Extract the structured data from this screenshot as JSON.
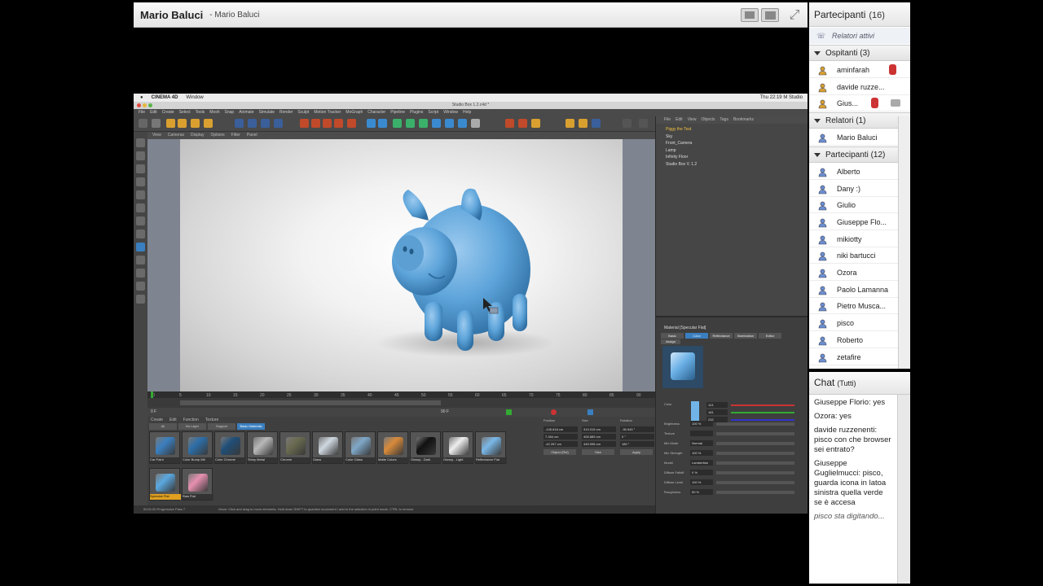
{
  "share_pod": {
    "presenter_name": "Mario Baluci",
    "subtitle": "- Mario Baluci",
    "mac_menu": [
      "CINEMA 4D",
      "Window"
    ],
    "mac_status": "Thu 22:19  M Studio",
    "c4d_title": "Studio Box 1.2.c4d *",
    "c4d_menu": [
      "File",
      "Edit",
      "Create",
      "Select",
      "Tools",
      "Mesh",
      "Snap",
      "Animate",
      "Simulate",
      "Render",
      "Sculpt",
      "Motion Tracker",
      "MoGraph",
      "Character",
      "Pipeline",
      "Plugins",
      "Script",
      "Window",
      "Help"
    ],
    "viewport_menu": [
      "View",
      "Cameras",
      "Display",
      "Options",
      "Filter",
      "Panel"
    ],
    "objects": [
      "Piggy the Test",
      "Sky",
      "Front_Camera",
      "Lamp",
      "Infinity Floor",
      "Studio Box V. 1.2"
    ],
    "object_manager_menu": [
      "File",
      "Edit",
      "View",
      "Objects",
      "Tags",
      "Bookmarks"
    ],
    "material_menu": [
      "Create",
      "Edit",
      "Function",
      "Texture"
    ],
    "material_tabs": [
      "All",
      "No Layer",
      "Support",
      "Basic Materials"
    ],
    "materials": [
      {
        "label": "Car Paint",
        "color": "#3a7fc0"
      },
      {
        "label": "Color Bump Mtl",
        "color": "#2c6ea8"
      },
      {
        "label": "Color Chrome",
        "color": "#1f4e78"
      },
      {
        "label": "Shiny Metal",
        "color": "#b8b8b8"
      },
      {
        "label": "Chrome",
        "color": "#6a6a50"
      },
      {
        "label": "Glass",
        "color": "#cfd8e0"
      },
      {
        "label": "Color Glass",
        "color": "#7fa8c8"
      },
      {
        "label": "Matte Colors",
        "color": "#d98a3a"
      },
      {
        "label": "Glossy - Dark",
        "color": "#111111"
      },
      {
        "label": "Glossy - Light",
        "color": "#eeeeee"
      },
      {
        "label": "Reflectance Flat",
        "color": "#7ab8e8"
      },
      {
        "label": "Specular Flat",
        "color": "#5aa8e0"
      },
      {
        "label": "Raw Flat",
        "color": "#e890b0"
      }
    ],
    "coord_labels": [
      "Position",
      "Size",
      "Rotation"
    ],
    "coord_values": [
      "-135.618 cm",
      "319.315 cm",
      "-35.945 °",
      "7.284 cm",
      "406.889 cm",
      "0 °",
      "-42.267 cm",
      "445.998 cm",
      "180 °"
    ],
    "coord_buttons": [
      "Object (Rel)",
      "Size",
      "Apply"
    ],
    "attr_title": "Material [Specular Flat]",
    "attr_tabs": [
      "Basic",
      "Color",
      "Reflectance",
      "Illumination",
      "Editor"
    ],
    "attr_assign": "Assign",
    "attr_fields": [
      {
        "label": "Color",
        "value": ""
      },
      {
        "label": "Brightness",
        "value": "100 %"
      },
      {
        "label": "Texture",
        "value": ""
      },
      {
        "label": "Mix Mode",
        "value": "Normal"
      },
      {
        "label": "Mix Strength",
        "value": "100 %"
      },
      {
        "label": "Model",
        "value": "Lambertian"
      },
      {
        "label": "Diffuse Falloff",
        "value": "0 %"
      },
      {
        "label": "Diffuse Level",
        "value": "100 %"
      },
      {
        "label": "Roughness",
        "value": "50 %"
      }
    ],
    "rgb": [
      "113",
      "181",
      "232"
    ],
    "status_text": "Move: Click and drag to move elements. Hold down SHIFT to quantize movement / add to the selection in point mode, CTRL to remove.",
    "status_left": "00:01:00  Progressive Pass 7",
    "timeline_ticks": [
      "0",
      "5",
      "10",
      "15",
      "20",
      "25",
      "30",
      "35",
      "40",
      "45",
      "50",
      "55",
      "60",
      "65",
      "70",
      "75",
      "80",
      "85",
      "90"
    ],
    "frame_start": "0 F",
    "frame_end": "90 F"
  },
  "participants": {
    "title": "Partecipanti",
    "count": "(16)",
    "active_speakers": "Relatori attivi",
    "groups": [
      {
        "title": "Ospitanti (3)",
        "items": [
          "aminfarah",
          "davide ruzze...",
          "Gius..."
        ]
      },
      {
        "title": "Relatori (1)",
        "items": [
          "Mario Baluci"
        ]
      },
      {
        "title": "Partecipanti (12)",
        "items": [
          "Alberto",
          "Dany :)",
          "Giulio",
          "Giuseppe Flo...",
          "mikiotty",
          "niki bartucci",
          "Ozora",
          "Paolo Lamanna",
          "Pietro Musca...",
          "pisco",
          "Roberto",
          "zetafire"
        ]
      }
    ]
  },
  "chat": {
    "title": "Chat",
    "scope": "(Tutti)",
    "messages": [
      "Giuseppe Florio: yes",
      "Ozora: yes",
      "davide ruzzenenti: pisco con che browser sei entrato?",
      "Giuseppe Guglielmucci: pisco, guarda icona in latoa sinistra quella verde se è accesa"
    ],
    "typing": "pisco sta digitando..."
  },
  "colors": {
    "accent": "#3a7fc0",
    "pig": "#6aaede"
  }
}
